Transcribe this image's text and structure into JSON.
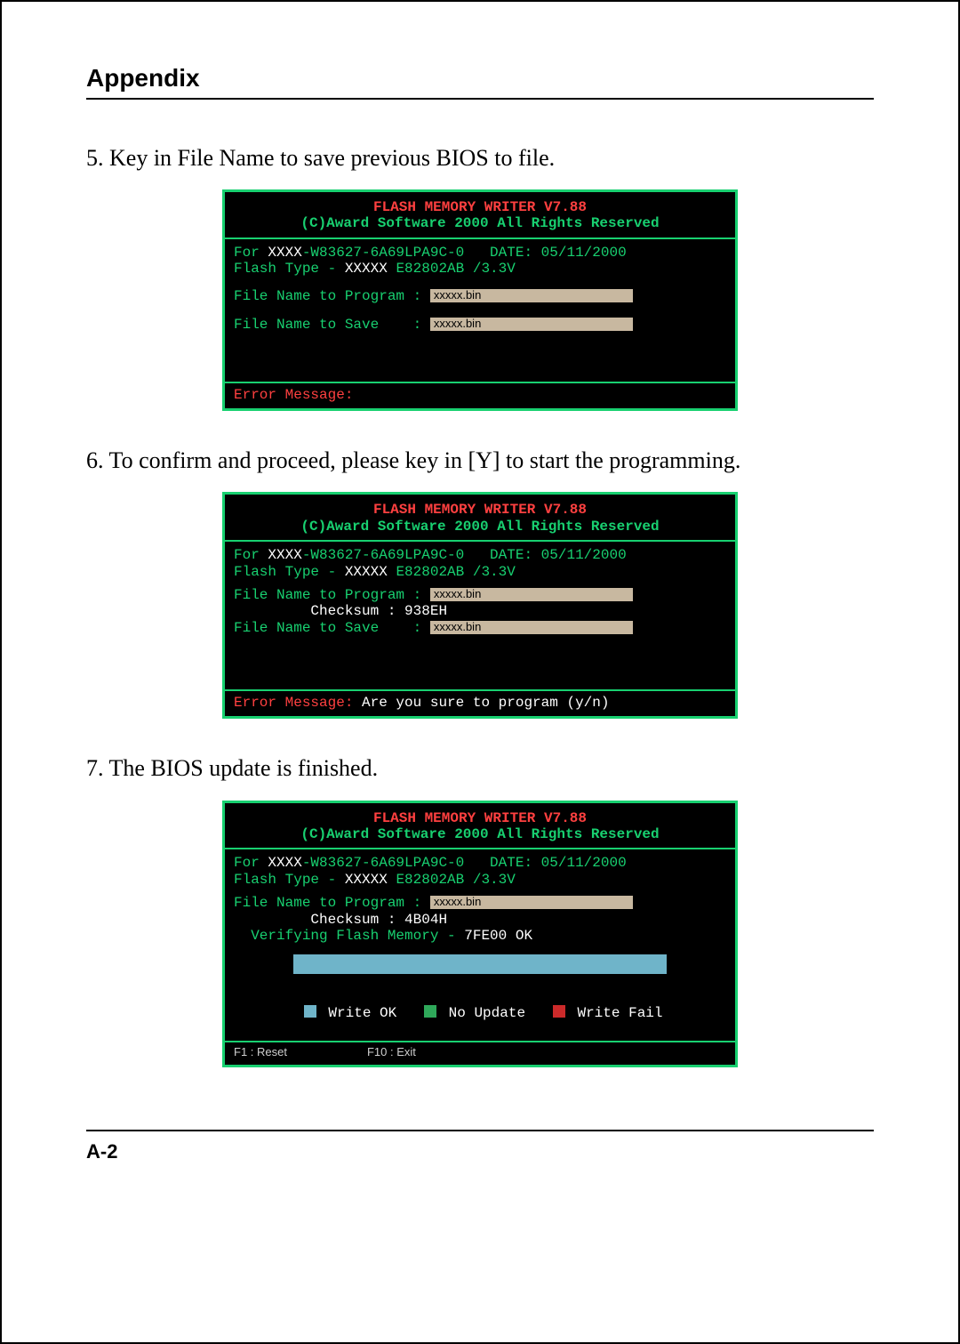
{
  "header": {
    "title": "Appendix"
  },
  "footer": {
    "page": "A-2"
  },
  "steps": {
    "s5": "5. Key in File Name to save previous BIOS to file.",
    "s6": "6. To confirm and proceed, please key in [Y] to start the programming.",
    "s7": "7. The BIOS update is finished."
  },
  "common": {
    "title1": "FLASH  MEMORY  WRITER V7.88",
    "title2": "(C)Award Software 2000 All Rights Reserved",
    "for_prefix": "For ",
    "for_xxxx": "XXXX",
    "for_id": "-W83627-6A69LPA9C-0",
    "date_label": "   DATE: ",
    "date": "05/11/2000",
    "flash_label": "Flash Type - ",
    "flash_xxxxx": "XXXXX ",
    "flash_chip": "E82802AB /3.3V",
    "fn_program_label": "File Name to Program : ",
    "fn_save_label": "File Name to Save    : ",
    "checksum_label": "         Checksum : ",
    "file_value": "xxxxx.bin",
    "err_label": "Error Message:"
  },
  "shot2": {
    "checksum": "938EH",
    "err_msg": "  Are you sure to program (y/n)"
  },
  "shot3": {
    "checksum": "4B04H",
    "verify_label": "  Verifying Flash Memory - ",
    "verify_val": "7FE00 OK",
    "legend_ok": " Write OK",
    "legend_no": " No Update",
    "legend_fail": " Write Fail",
    "f1": "F1 : Reset",
    "f10": "F10 : Exit"
  }
}
